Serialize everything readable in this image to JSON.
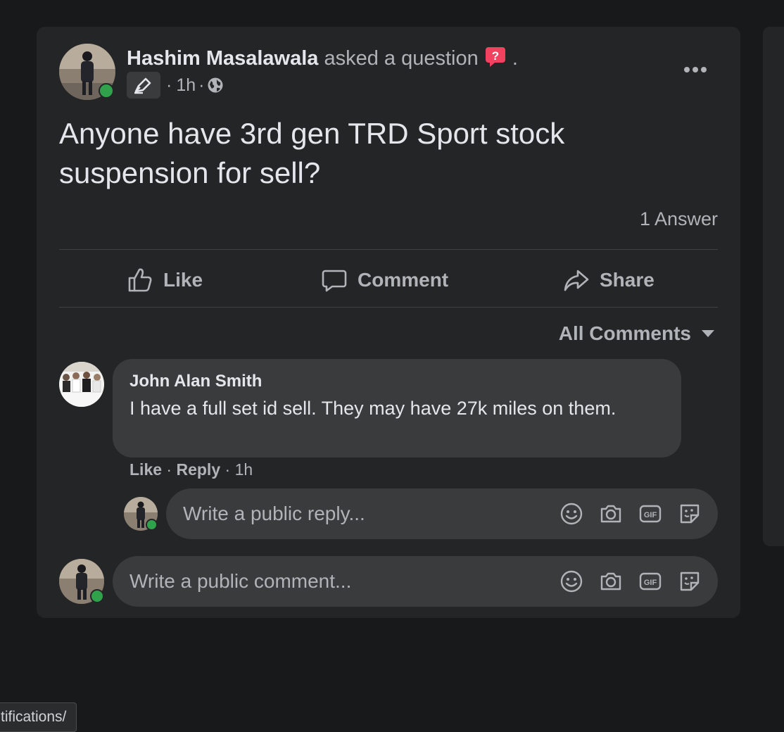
{
  "post": {
    "author": "Hashim Masalawala",
    "action_text": "asked a question",
    "trailing_dot": ".",
    "time": "1h",
    "separator": "·",
    "question": "Anyone have 3rd gen TRD Sport stock suspension for sell?",
    "answer_count": "1 Answer",
    "icons": {
      "more": "more-options-icon",
      "badge": "pen-badge-icon",
      "privacy": "globe-icon",
      "question": "question-mark-badge-icon"
    }
  },
  "actions": {
    "like": "Like",
    "comment": "Comment",
    "share": "Share"
  },
  "comments_filter": {
    "label": "All Comments"
  },
  "comment": {
    "author": "John Alan Smith",
    "text": "I have a full set id sell. They may have 27k miles on them.",
    "like": "Like",
    "reply": "Reply",
    "time": "1h"
  },
  "reply_input": {
    "placeholder": "Write a public reply..."
  },
  "comment_input": {
    "placeholder": "Write a public comment..."
  },
  "input_icons": [
    "emoji-icon",
    "camera-icon",
    "gif-icon",
    "sticker-icon"
  ],
  "status_bar": {
    "url": "tifications/"
  },
  "colors": {
    "background": "#18191a",
    "card": "#242526",
    "bubble": "#3a3b3c",
    "online": "#31a24c",
    "question_badge": "#f3425f"
  }
}
